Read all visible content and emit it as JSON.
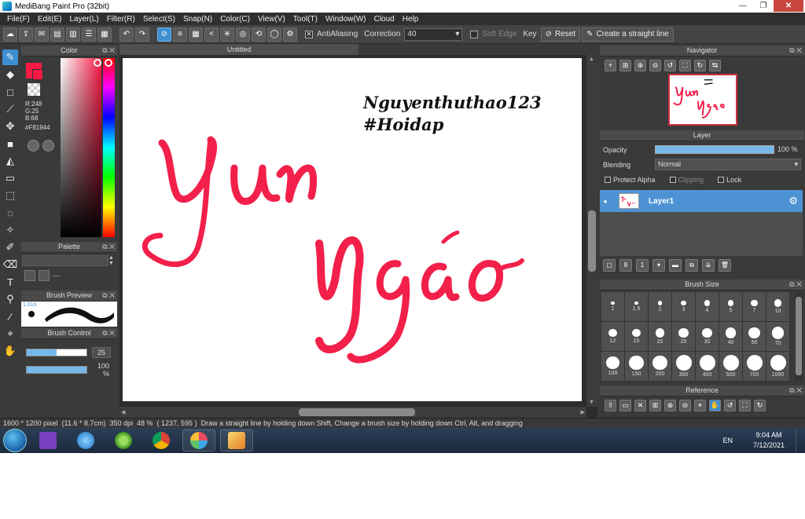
{
  "window": {
    "title": "MediBang Paint Pro (32bit)"
  },
  "menu": [
    "File(F)",
    "Edit(E)",
    "Layer(L)",
    "Filter(R)",
    "Select(S)",
    "Snap(N)",
    "Color(C)",
    "View(V)",
    "Tool(T)",
    "Window(W)",
    "Cloud",
    "Help"
  ],
  "toolbar": {
    "antialiasing_label": "AntiAliasing",
    "correction_label": "Correction",
    "correction_value": "40",
    "soft_edge_label": "Soft Edge",
    "key_label": "Key",
    "reset_label": "Reset",
    "straight_line_label": "Create a straight line"
  },
  "color_panel": {
    "title": "Color",
    "r": "R:248",
    "g": "G:25",
    "b": "B:68",
    "hex": "#F81944",
    "current_color": "#f81944"
  },
  "palette_panel": {
    "title": "Palette",
    "value": "---"
  },
  "brush_preview": {
    "title": "Brush Preview",
    "size": "1.01n"
  },
  "brush_control": {
    "title": "Brush Control",
    "size_value": "25",
    "size_fraction": 0.5,
    "opacity_value": "100 %",
    "opacity_fraction": 1.0
  },
  "canvas": {
    "tab_title": "Untitled",
    "artwork": {
      "signature_line1": "Nguyenthuthao123",
      "signature_line2": "#Hoidap",
      "lettering": "Yun Ngáo"
    }
  },
  "navigator": {
    "title": "Navigator"
  },
  "layer_panel": {
    "title": "Layer",
    "opacity_label": "Opacity",
    "opacity_value": "100 %",
    "blending_label": "Blending",
    "blending_value": "Normal",
    "protect_alpha_label": "Protect Alpha",
    "clipping_label": "Clipping",
    "lock_label": "Lock",
    "layers": [
      {
        "name": "Layer1"
      }
    ]
  },
  "brush_size": {
    "title": "Brush Size",
    "sizes": [
      "1",
      "1.5",
      "2",
      "3",
      "4",
      "5",
      "7",
      "10",
      "12",
      "15",
      "20",
      "25",
      "30",
      "40",
      "50",
      "70",
      "100",
      "150",
      "200",
      "300",
      "400",
      "500",
      "700",
      "1000"
    ]
  },
  "reference": {
    "title": "Reference"
  },
  "status": {
    "dimensions": "1600 * 1200 pixel",
    "physical": "(11.6 * 8.7cm)",
    "dpi": "350 dpi",
    "zoom": "48 %",
    "cursor": "( 1237, 595 )",
    "hint": "Draw a straight line by holding down Shift, Change a brush size by holding down Ctrl, Alt, and dragging"
  },
  "taskbar": {
    "language": "EN",
    "time": "9:04 AM",
    "date": "7/12/2021"
  }
}
